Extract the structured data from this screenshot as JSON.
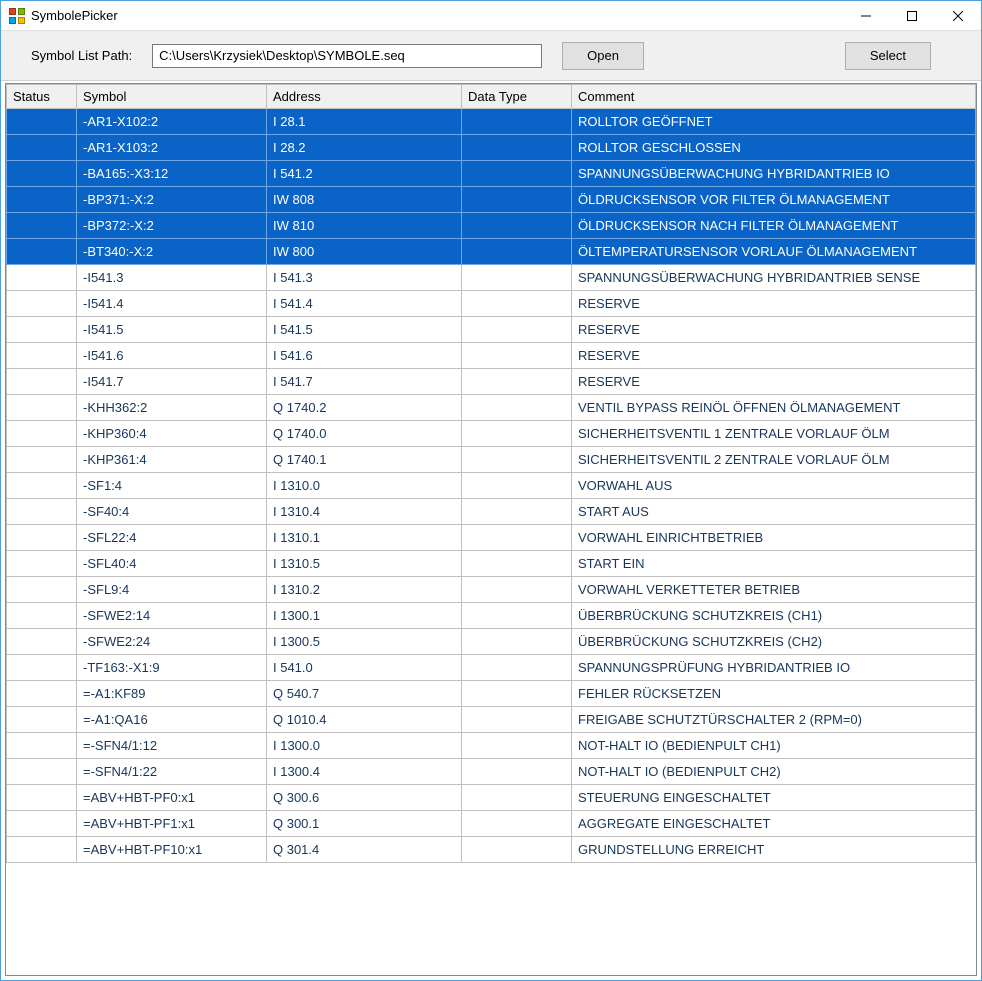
{
  "window": {
    "title": "SymbolePicker"
  },
  "toolbar": {
    "path_label": "Symbol List Path:",
    "path_value": "C:\\Users\\Krzysiek\\Desktop\\SYMBOLE.seq",
    "open_label": "Open",
    "select_label": "Select"
  },
  "columns": {
    "status": "Status",
    "symbol": "Symbol",
    "address": "Address",
    "datatype": "Data Type",
    "comment": "Comment"
  },
  "rows": [
    {
      "selected": true,
      "status": "",
      "symbol": "-AR1-X102:2",
      "address": "I 28.1",
      "datatype": "",
      "comment": "ROLLTOR GEÖFFNET"
    },
    {
      "selected": true,
      "status": "",
      "symbol": "-AR1-X103:2",
      "address": "I 28.2",
      "datatype": "",
      "comment": "ROLLTOR GESCHLOSSEN"
    },
    {
      "selected": true,
      "status": "",
      "symbol": "-BA165:-X3:12",
      "address": "I 541.2",
      "datatype": "",
      "comment": "SPANNUNGSÜBERWACHUNG HYBRIDANTRIEB IO"
    },
    {
      "selected": true,
      "status": "",
      "symbol": "-BP371:-X:2",
      "address": "IW 808",
      "datatype": "",
      "comment": "ÖLDRUCKSENSOR VOR FILTER ÖLMANAGEMENT"
    },
    {
      "selected": true,
      "status": "",
      "symbol": "-BP372:-X:2",
      "address": "IW 810",
      "datatype": "",
      "comment": "ÖLDRUCKSENSOR NACH FILTER ÖLMANAGEMENT"
    },
    {
      "selected": true,
      "status": "",
      "symbol": "-BT340:-X:2",
      "address": "IW 800",
      "datatype": "",
      "comment": "ÖLTEMPERATURSENSOR VORLAUF ÖLMANAGEMENT"
    },
    {
      "selected": false,
      "status": "",
      "symbol": "-I541.3",
      "address": "I 541.3",
      "datatype": "",
      "comment": "SPANNUNGSÜBERWACHUNG HYBRIDANTRIEB SENSE"
    },
    {
      "selected": false,
      "status": "",
      "symbol": "-I541.4",
      "address": "I 541.4",
      "datatype": "",
      "comment": "RESERVE"
    },
    {
      "selected": false,
      "status": "",
      "symbol": "-I541.5",
      "address": "I 541.5",
      "datatype": "",
      "comment": "RESERVE"
    },
    {
      "selected": false,
      "status": "",
      "symbol": "-I541.6",
      "address": "I 541.6",
      "datatype": "",
      "comment": "RESERVE"
    },
    {
      "selected": false,
      "status": "",
      "symbol": "-I541.7",
      "address": "I 541.7",
      "datatype": "",
      "comment": "RESERVE"
    },
    {
      "selected": false,
      "status": "",
      "symbol": "-KHH362:2",
      "address": "Q 1740.2",
      "datatype": "",
      "comment": "VENTIL BYPASS REINÖL ÖFFNEN ÖLMANAGEMENT"
    },
    {
      "selected": false,
      "status": "",
      "symbol": "-KHP360:4",
      "address": "Q 1740.0",
      "datatype": "",
      "comment": "SICHERHEITSVENTIL 1 ZENTRALE VORLAUF ÖLM"
    },
    {
      "selected": false,
      "status": "",
      "symbol": "-KHP361:4",
      "address": "Q 1740.1",
      "datatype": "",
      "comment": "SICHERHEITSVENTIL 2 ZENTRALE VORLAUF ÖLM"
    },
    {
      "selected": false,
      "status": "",
      "symbol": "-SF1:4",
      "address": "I 1310.0",
      "datatype": "",
      "comment": "VORWAHL AUS"
    },
    {
      "selected": false,
      "status": "",
      "symbol": "-SF40:4",
      "address": "I 1310.4",
      "datatype": "",
      "comment": "START AUS"
    },
    {
      "selected": false,
      "status": "",
      "symbol": "-SFL22:4",
      "address": "I 1310.1",
      "datatype": "",
      "comment": "VORWAHL EINRICHTBETRIEB"
    },
    {
      "selected": false,
      "status": "",
      "symbol": "-SFL40:4",
      "address": "I 1310.5",
      "datatype": "",
      "comment": "START EIN"
    },
    {
      "selected": false,
      "status": "",
      "symbol": "-SFL9:4",
      "address": "I 1310.2",
      "datatype": "",
      "comment": "VORWAHL VERKETTETER BETRIEB"
    },
    {
      "selected": false,
      "status": "",
      "symbol": "-SFWE2:14",
      "address": "I 1300.1",
      "datatype": "",
      "comment": "ÜBERBRÜCKUNG SCHUTZKREIS (CH1)"
    },
    {
      "selected": false,
      "status": "",
      "symbol": "-SFWE2:24",
      "address": "I 1300.5",
      "datatype": "",
      "comment": "ÜBERBRÜCKUNG SCHUTZKREIS (CH2)"
    },
    {
      "selected": false,
      "status": "",
      "symbol": "-TF163:-X1:9",
      "address": "I 541.0",
      "datatype": "",
      "comment": "SPANNUNGSPRÜFUNG HYBRIDANTRIEB IO"
    },
    {
      "selected": false,
      "status": "",
      "symbol": "=-A1:KF89",
      "address": "Q 540.7",
      "datatype": "",
      "comment": "FEHLER RÜCKSETZEN"
    },
    {
      "selected": false,
      "status": "",
      "symbol": "=-A1:QA16",
      "address": "Q 1010.4",
      "datatype": "",
      "comment": "FREIGABE SCHUTZTÜRSCHALTER 2 (RPM=0)"
    },
    {
      "selected": false,
      "status": "",
      "symbol": "=-SFN4/1:12",
      "address": "I 1300.0",
      "datatype": "",
      "comment": "NOT-HALT IO (BEDIENPULT CH1)"
    },
    {
      "selected": false,
      "status": "",
      "symbol": "=-SFN4/1:22",
      "address": "I 1300.4",
      "datatype": "",
      "comment": "NOT-HALT IO (BEDIENPULT CH2)"
    },
    {
      "selected": false,
      "status": "",
      "symbol": "=ABV+HBT-PF0:x1",
      "address": "Q 300.6",
      "datatype": "",
      "comment": "STEUERUNG EINGESCHALTET"
    },
    {
      "selected": false,
      "status": "",
      "symbol": "=ABV+HBT-PF1:x1",
      "address": "Q 300.1",
      "datatype": "",
      "comment": "AGGREGATE EINGESCHALTET"
    },
    {
      "selected": false,
      "status": "",
      "symbol": "=ABV+HBT-PF10:x1",
      "address": "Q 301.4",
      "datatype": "",
      "comment": "GRUNDSTELLUNG ERREICHT"
    }
  ]
}
